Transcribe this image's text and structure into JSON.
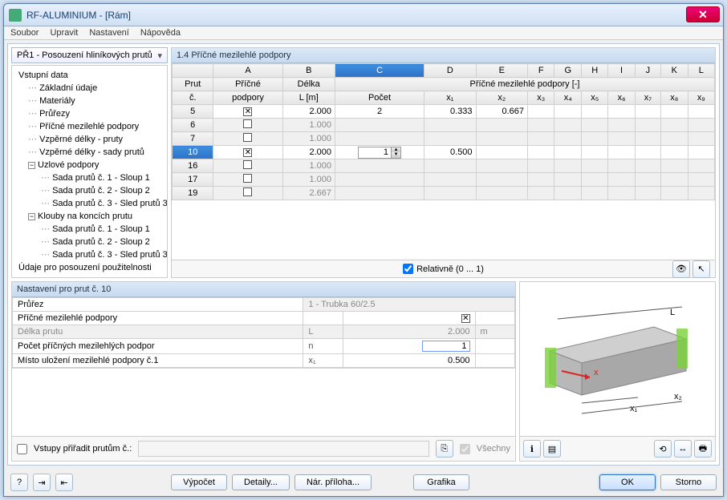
{
  "window": {
    "title": "RF-ALUMINIUM - [Rám]"
  },
  "menu": {
    "file": "Soubor",
    "edit": "Upravit",
    "settings": "Nastavení",
    "help": "Nápověda"
  },
  "combo": {
    "value": "PŘ1 - Posouzení hliníkových prutů"
  },
  "tree": {
    "items": [
      {
        "lvl": 0,
        "label": "Vstupní data",
        "exp": ""
      },
      {
        "lvl": 1,
        "label": "Základní údaje"
      },
      {
        "lvl": 1,
        "label": "Materiály"
      },
      {
        "lvl": 1,
        "label": "Průřezy"
      },
      {
        "lvl": 1,
        "label": "Příčné mezilehlé podpory"
      },
      {
        "lvl": 1,
        "label": "Vzpěrné délky - pruty"
      },
      {
        "lvl": 1,
        "label": "Vzpěrné délky - sady prutů"
      },
      {
        "lvl": 1,
        "label": "Uzlové podpory",
        "exp": "−"
      },
      {
        "lvl": 2,
        "label": "Sada prutů č. 1 - Sloup 1"
      },
      {
        "lvl": 2,
        "label": "Sada prutů č. 2 - Sloup 2"
      },
      {
        "lvl": 2,
        "label": "Sada prutů č. 3 - Sled prutů 3"
      },
      {
        "lvl": 1,
        "label": "Klouby na koncích prutu",
        "exp": "−"
      },
      {
        "lvl": 2,
        "label": "Sada prutů č. 1 - Sloup 1"
      },
      {
        "lvl": 2,
        "label": "Sada prutů č. 2 - Sloup 2"
      },
      {
        "lvl": 2,
        "label": "Sada prutů č. 3 - Sled prutů 3"
      },
      {
        "lvl": 0,
        "label": "Údaje pro posouzení použitelnosti"
      }
    ]
  },
  "grid": {
    "title": "1.4 Příčné mezilehlé podpory",
    "colLetters": [
      "A",
      "B",
      "C",
      "D",
      "E",
      "F",
      "G",
      "H",
      "I",
      "J",
      "K",
      "L"
    ],
    "h1_prut": "Prut",
    "h1_pricne": "Příčné",
    "h1_delka": "Délka",
    "h1_span": "Příčné mezilehlé podpory [-]",
    "h2_c": "č.",
    "h2_podpory": "podpory",
    "h2_L": "L [m]",
    "h2_pocet": "Počet",
    "h2_x": [
      "x₁",
      "x₂",
      "x₃",
      "x₄",
      "x₅",
      "x₆",
      "x₇",
      "x₈",
      "x₉"
    ],
    "rows": [
      {
        "n": "5",
        "chk": true,
        "L": "2.000",
        "count": "2",
        "x": [
          "0.333",
          "0.667"
        ]
      },
      {
        "n": "6",
        "chk": false,
        "L": "1.000",
        "grey": true
      },
      {
        "n": "7",
        "chk": false,
        "L": "1.000",
        "grey": true
      },
      {
        "n": "10",
        "chk": true,
        "L": "2.000",
        "count_edit": "1",
        "x": [
          "0.500"
        ],
        "sel": true
      },
      {
        "n": "16",
        "chk": false,
        "L": "1.000",
        "grey": true
      },
      {
        "n": "17",
        "chk": false,
        "L": "1.000",
        "grey": true
      },
      {
        "n": "19",
        "chk": false,
        "L": "2.667",
        "grey": true
      }
    ],
    "relative": "Relativně (0 ... 1)"
  },
  "detail": {
    "title": "Nastavení pro prut č. 10",
    "rows": [
      {
        "lbl": "Průřez",
        "sym": "",
        "val": "1 - Trubka 60/2.5",
        "span": true,
        "grey": true
      },
      {
        "lbl": "Příčné mezilehlé podpory",
        "sym": "",
        "val": "chk",
        "unit": ""
      },
      {
        "lbl": "Délka prutu",
        "sym": "L",
        "val": "2.000",
        "unit": "m",
        "grey": true
      },
      {
        "lbl": "Počet příčných mezilehlých podpor",
        "sym": "n",
        "val": "1",
        "unit": "",
        "edit": true
      },
      {
        "lbl": "Místo uložení mezilehlé podpory č.1",
        "sym": "x₁",
        "val": "0.500",
        "unit": ""
      }
    ],
    "assign": "Vstupy přiřadit prutům č.:",
    "all": "Všechny"
  },
  "preview": {
    "L": "L",
    "x1": "x₁",
    "x2": "x₂",
    "arrow": "x"
  },
  "buttons": {
    "calc": "Výpočet",
    "details": "Detaily...",
    "nat": "Nár. příloha...",
    "graphics": "Grafika",
    "ok": "OK",
    "cancel": "Storno"
  }
}
